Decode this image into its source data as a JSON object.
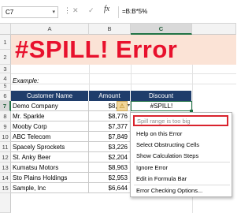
{
  "formula_bar": {
    "name_box": "C7",
    "dots": "⋮",
    "cancel_icon": "✕",
    "enter_icon": "✓",
    "fx": "fx",
    "formula": "=B:B*5%"
  },
  "columns": [
    "A",
    "B",
    "C"
  ],
  "rows": [
    "1",
    "2",
    "3",
    "4",
    "5",
    "6",
    "7",
    "8",
    "9",
    "10",
    "11",
    "12",
    "13",
    "14",
    "15"
  ],
  "title": "#SPILL! Error",
  "example_label": "Example:",
  "table": {
    "headers": [
      "Customer Name",
      "Amount",
      "Discount"
    ],
    "rows": [
      {
        "name": "Demo Company",
        "amount": "$8,070",
        "discount": "#SPILL!"
      },
      {
        "name": "Mr. Sparkle",
        "amount": "$8,776",
        "discount": ""
      },
      {
        "name": "Mooby Corp",
        "amount": "$7,377",
        "discount": ""
      },
      {
        "name": "ABC Telecom",
        "amount": "$7,849",
        "discount": ""
      },
      {
        "name": "Spacely Sprockets",
        "amount": "$3,226",
        "discount": ""
      },
      {
        "name": "St. Anky Beer",
        "amount": "$2,204",
        "discount": ""
      },
      {
        "name": "Kumatsu Motors",
        "amount": "$8,963",
        "discount": ""
      },
      {
        "name": "Sto Plains Holdings",
        "amount": "$2,953",
        "discount": ""
      },
      {
        "name": "Sample, Inc",
        "amount": "$6,644",
        "discount": ""
      }
    ]
  },
  "warning_icon": "⚠",
  "warning_dropdown": "▾",
  "context_menu": {
    "items": [
      "Spill range is too big",
      "Help on this Error",
      "Select Obstructing Cells",
      "Show Calculation Steps",
      "Ignore Error",
      "Edit in Formula Bar",
      "Error Checking Options..."
    ]
  },
  "colors": {
    "title_red": "#e8112d",
    "title_band": "#fbe3d6",
    "header_navy": "#1f3d6b",
    "excel_green": "#217346",
    "highlight_red": "#d9232d"
  }
}
